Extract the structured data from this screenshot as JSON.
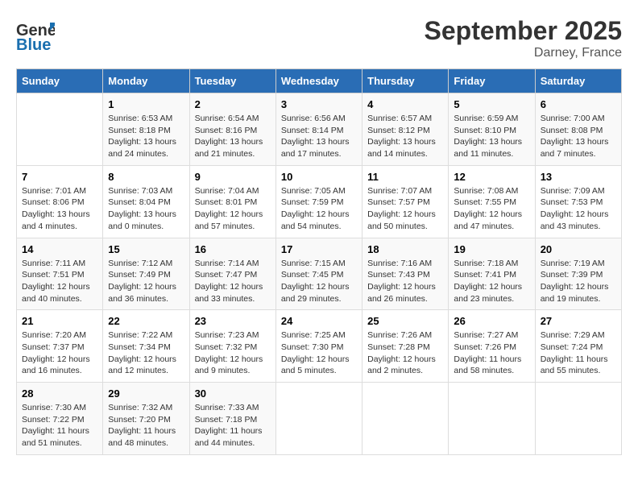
{
  "logo": {
    "line1": "General",
    "line2": "Blue"
  },
  "title": "September 2025",
  "location": "Darney, France",
  "days_header": [
    "Sunday",
    "Monday",
    "Tuesday",
    "Wednesday",
    "Thursday",
    "Friday",
    "Saturday"
  ],
  "weeks": [
    [
      {
        "day": "",
        "content": ""
      },
      {
        "day": "1",
        "content": "Sunrise: 6:53 AM\nSunset: 8:18 PM\nDaylight: 13 hours\nand 24 minutes."
      },
      {
        "day": "2",
        "content": "Sunrise: 6:54 AM\nSunset: 8:16 PM\nDaylight: 13 hours\nand 21 minutes."
      },
      {
        "day": "3",
        "content": "Sunrise: 6:56 AM\nSunset: 8:14 PM\nDaylight: 13 hours\nand 17 minutes."
      },
      {
        "day": "4",
        "content": "Sunrise: 6:57 AM\nSunset: 8:12 PM\nDaylight: 13 hours\nand 14 minutes."
      },
      {
        "day": "5",
        "content": "Sunrise: 6:59 AM\nSunset: 8:10 PM\nDaylight: 13 hours\nand 11 minutes."
      },
      {
        "day": "6",
        "content": "Sunrise: 7:00 AM\nSunset: 8:08 PM\nDaylight: 13 hours\nand 7 minutes."
      }
    ],
    [
      {
        "day": "7",
        "content": "Sunrise: 7:01 AM\nSunset: 8:06 PM\nDaylight: 13 hours\nand 4 minutes."
      },
      {
        "day": "8",
        "content": "Sunrise: 7:03 AM\nSunset: 8:04 PM\nDaylight: 13 hours\nand 0 minutes."
      },
      {
        "day": "9",
        "content": "Sunrise: 7:04 AM\nSunset: 8:01 PM\nDaylight: 12 hours\nand 57 minutes."
      },
      {
        "day": "10",
        "content": "Sunrise: 7:05 AM\nSunset: 7:59 PM\nDaylight: 12 hours\nand 54 minutes."
      },
      {
        "day": "11",
        "content": "Sunrise: 7:07 AM\nSunset: 7:57 PM\nDaylight: 12 hours\nand 50 minutes."
      },
      {
        "day": "12",
        "content": "Sunrise: 7:08 AM\nSunset: 7:55 PM\nDaylight: 12 hours\nand 47 minutes."
      },
      {
        "day": "13",
        "content": "Sunrise: 7:09 AM\nSunset: 7:53 PM\nDaylight: 12 hours\nand 43 minutes."
      }
    ],
    [
      {
        "day": "14",
        "content": "Sunrise: 7:11 AM\nSunset: 7:51 PM\nDaylight: 12 hours\nand 40 minutes."
      },
      {
        "day": "15",
        "content": "Sunrise: 7:12 AM\nSunset: 7:49 PM\nDaylight: 12 hours\nand 36 minutes."
      },
      {
        "day": "16",
        "content": "Sunrise: 7:14 AM\nSunset: 7:47 PM\nDaylight: 12 hours\nand 33 minutes."
      },
      {
        "day": "17",
        "content": "Sunrise: 7:15 AM\nSunset: 7:45 PM\nDaylight: 12 hours\nand 29 minutes."
      },
      {
        "day": "18",
        "content": "Sunrise: 7:16 AM\nSunset: 7:43 PM\nDaylight: 12 hours\nand 26 minutes."
      },
      {
        "day": "19",
        "content": "Sunrise: 7:18 AM\nSunset: 7:41 PM\nDaylight: 12 hours\nand 23 minutes."
      },
      {
        "day": "20",
        "content": "Sunrise: 7:19 AM\nSunset: 7:39 PM\nDaylight: 12 hours\nand 19 minutes."
      }
    ],
    [
      {
        "day": "21",
        "content": "Sunrise: 7:20 AM\nSunset: 7:37 PM\nDaylight: 12 hours\nand 16 minutes."
      },
      {
        "day": "22",
        "content": "Sunrise: 7:22 AM\nSunset: 7:34 PM\nDaylight: 12 hours\nand 12 minutes."
      },
      {
        "day": "23",
        "content": "Sunrise: 7:23 AM\nSunset: 7:32 PM\nDaylight: 12 hours\nand 9 minutes."
      },
      {
        "day": "24",
        "content": "Sunrise: 7:25 AM\nSunset: 7:30 PM\nDaylight: 12 hours\nand 5 minutes."
      },
      {
        "day": "25",
        "content": "Sunrise: 7:26 AM\nSunset: 7:28 PM\nDaylight: 12 hours\nand 2 minutes."
      },
      {
        "day": "26",
        "content": "Sunrise: 7:27 AM\nSunset: 7:26 PM\nDaylight: 11 hours\nand 58 minutes."
      },
      {
        "day": "27",
        "content": "Sunrise: 7:29 AM\nSunset: 7:24 PM\nDaylight: 11 hours\nand 55 minutes."
      }
    ],
    [
      {
        "day": "28",
        "content": "Sunrise: 7:30 AM\nSunset: 7:22 PM\nDaylight: 11 hours\nand 51 minutes."
      },
      {
        "day": "29",
        "content": "Sunrise: 7:32 AM\nSunset: 7:20 PM\nDaylight: 11 hours\nand 48 minutes."
      },
      {
        "day": "30",
        "content": "Sunrise: 7:33 AM\nSunset: 7:18 PM\nDaylight: 11 hours\nand 44 minutes."
      },
      {
        "day": "",
        "content": ""
      },
      {
        "day": "",
        "content": ""
      },
      {
        "day": "",
        "content": ""
      },
      {
        "day": "",
        "content": ""
      }
    ]
  ]
}
